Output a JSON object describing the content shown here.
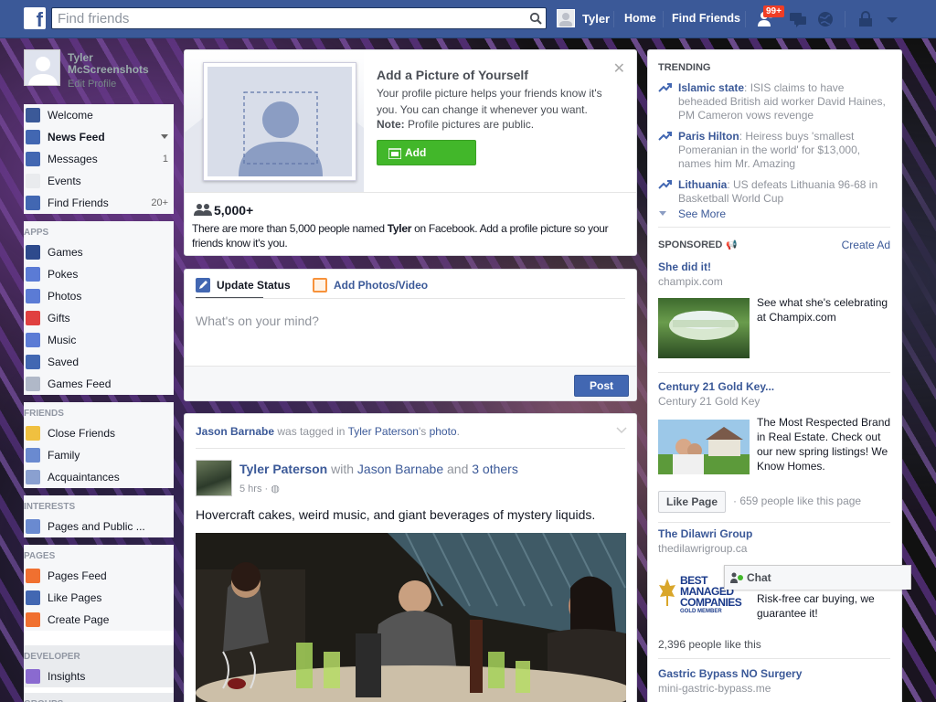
{
  "topbar": {
    "search_placeholder": "Find friends",
    "user_name": "Tyler",
    "home": "Home",
    "find_friends": "Find Friends",
    "notif_count": "99+"
  },
  "sidebar": {
    "profile_name": "Tyler McScreenshots",
    "edit_profile": "Edit Profile",
    "favorites": [
      {
        "label": "Welcome",
        "icon": "facebook-icon",
        "count": ""
      },
      {
        "label": "News Feed",
        "icon": "news-feed-icon",
        "count": ""
      },
      {
        "label": "Messages",
        "icon": "messages-icon",
        "count": "1"
      },
      {
        "label": "Events",
        "icon": "events-icon",
        "count": ""
      },
      {
        "label": "Find Friends",
        "icon": "find-friends-icon",
        "count": "20+"
      }
    ],
    "apps_title": "APPS",
    "apps": [
      "Games",
      "Pokes",
      "Photos",
      "Gifts",
      "Music",
      "Saved",
      "Games Feed"
    ],
    "friends_title": "FRIENDS",
    "friends": [
      "Close Friends",
      "Family",
      "Acquaintances"
    ],
    "interests_title": "INTERESTS",
    "interests": [
      "Pages and Public ..."
    ],
    "pages_title": "PAGES",
    "pages": [
      "Pages Feed",
      "Like Pages",
      "Create Page"
    ],
    "developer_title": "DEVELOPER",
    "developer": [
      "Insights"
    ],
    "groups_title": "GROUPS"
  },
  "profile_prompt": {
    "title": "Add a Picture of Yourself",
    "body": "Your profile picture helps your friends know it's you. You can change it whenever you want.",
    "note_label": "Note:",
    "note_text": " Profile pictures are public.",
    "button": "Add Picture",
    "count": "5,000+",
    "count_text_pre": "There are more than 5,000 people named ",
    "count_name": "Tyler",
    "count_text_post": " on Facebook. Add a profile picture so your friends know it's you."
  },
  "composer": {
    "tab_status": "Update Status",
    "tab_photos": "Add Photos/Video",
    "placeholder": "What's on your mind?",
    "post_button": "Post"
  },
  "story": {
    "context_actor": "Jason Barnabe",
    "context_mid": " was tagged in ",
    "context_owner": "Tyler Paterson",
    "context_poss": "'s ",
    "context_photo": "photo",
    "context_end": ".",
    "author": "Tyler Paterson",
    "with": " with ",
    "tagged": "Jason Barnabe",
    "and": " and ",
    "others": "3 others",
    "time": "5 hrs",
    "text": "Hovercraft cakes, weird music, and giant beverages of mystery liquids."
  },
  "trending": {
    "title": "TRENDING",
    "items": [
      {
        "topic": "Islamic state",
        "desc": ": ISIS claims to have beheaded British aid worker David Haines, PM Cameron vows revenge"
      },
      {
        "topic": "Paris Hilton",
        "desc": ": Heiress buys 'smallest Pomeranian in the world' for $13,000, names him Mr. Amazing"
      },
      {
        "topic": "Lithuania",
        "desc": ": US defeats Lithuania 96-68 in Basketball World Cup"
      }
    ],
    "see_more": "See More"
  },
  "sponsored": {
    "title": "SPONSORED",
    "create_ad": "Create Ad",
    "ads": [
      {
        "head": "She did it!",
        "url": "champix.com",
        "text": "See what she's celebrating at Champix.com"
      },
      {
        "head": "Century 21 Gold Key...",
        "url": "Century 21 Gold Key",
        "text": "The Most Respected Brand in Real Estate. Check out our new spring listings! We Know Homes.",
        "like_btn": "Like Page",
        "likes": "· 659 people like this page"
      },
      {
        "head": "The Dilawri Group",
        "url": "thedilawrigroup.ca",
        "text": "Risk-free car buying, we guarantee it!",
        "logo_l1": "BEST",
        "logo_l2": "MANAGED",
        "logo_l3": "COMPANIES",
        "logo_l4": "GOLD MEMBER",
        "likes": "2,396 people like this"
      },
      {
        "head": "Gastric Bypass NO Surgery",
        "url": "mini-gastric-bypass.me"
      }
    ]
  },
  "chat": {
    "label": "Chat"
  }
}
